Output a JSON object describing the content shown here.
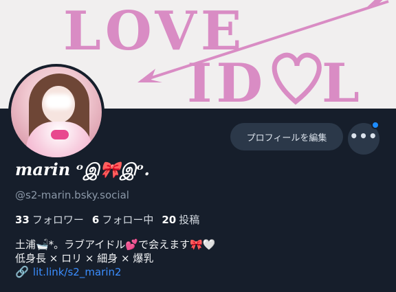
{
  "banner": {
    "line1": "LOVE",
    "line2": "ID",
    "line3": "L",
    "color": "#d98cc4"
  },
  "profile": {
    "display_name": "marin ᵒஇ🎀இᵒ.",
    "handle": "@s2-marin.bsky.social",
    "edit_label": "プロフィールを編集",
    "more_label": "•••",
    "stats": {
      "followers_count": "33",
      "followers_label": "フォロワー",
      "following_count": "6",
      "following_label": "フォロー中",
      "posts_count": "20",
      "posts_label": "投稿"
    },
    "bio": {
      "line1": "土浦🛁*。ラブアイドル💕で会えます🎀🤍",
      "line2": "低身長 × ロリ × 細身 × 爆乳",
      "link_icon": "🔗",
      "link_text": "lit.link/s2_marin2"
    }
  },
  "colors": {
    "background": "#161e2b",
    "button": "#2b3849",
    "link": "#3b8eff",
    "notification": "#1d8cff"
  }
}
